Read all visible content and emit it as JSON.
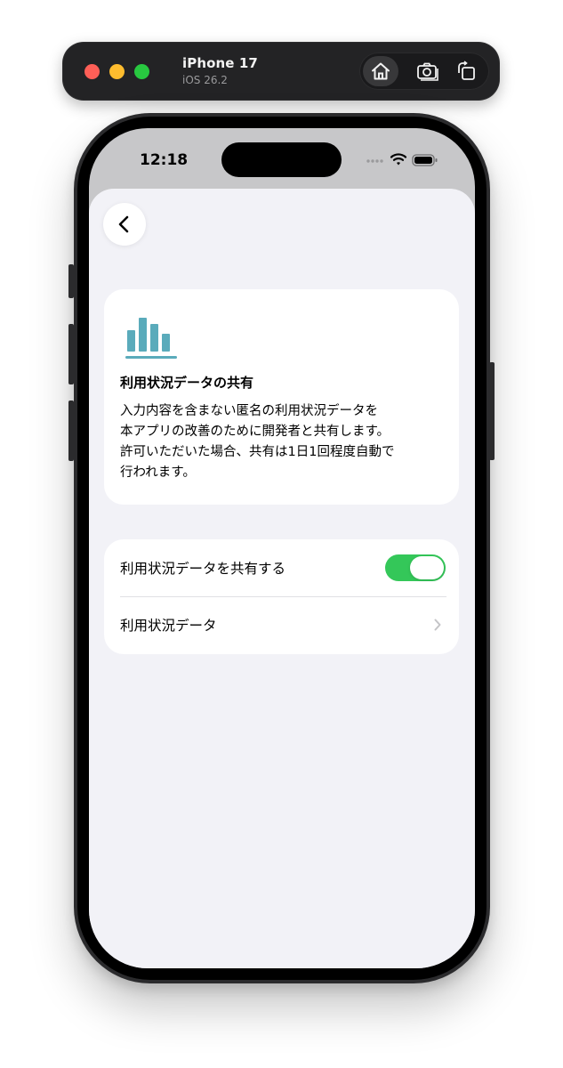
{
  "simulator": {
    "device_name": "iPhone 17",
    "os_version": "iOS 26.2",
    "actions": [
      "home-icon",
      "screenshot-icon",
      "rotate-icon"
    ]
  },
  "status_bar": {
    "time": "12:18",
    "icons": [
      "signal-icon",
      "wifi-icon",
      "battery-icon"
    ]
  },
  "nav": {
    "back_icon": "chevron-left-icon"
  },
  "info_card": {
    "icon": "bar-chart-icon",
    "icon_color": "#5aabbb",
    "title": "利用状況データの共有",
    "body_lines": [
      "入力内容を含まない匿名の利用状況データを",
      "本アプリの改善のために開発者と共有します。",
      "許可いただいた場合、共有は1日1回程度自動で",
      "行われます。"
    ]
  },
  "settings": {
    "share_toggle_label": "利用状況データを共有する",
    "share_toggle_on": true,
    "toggle_color": "#34c759",
    "usage_data_label": "利用状況データ"
  }
}
